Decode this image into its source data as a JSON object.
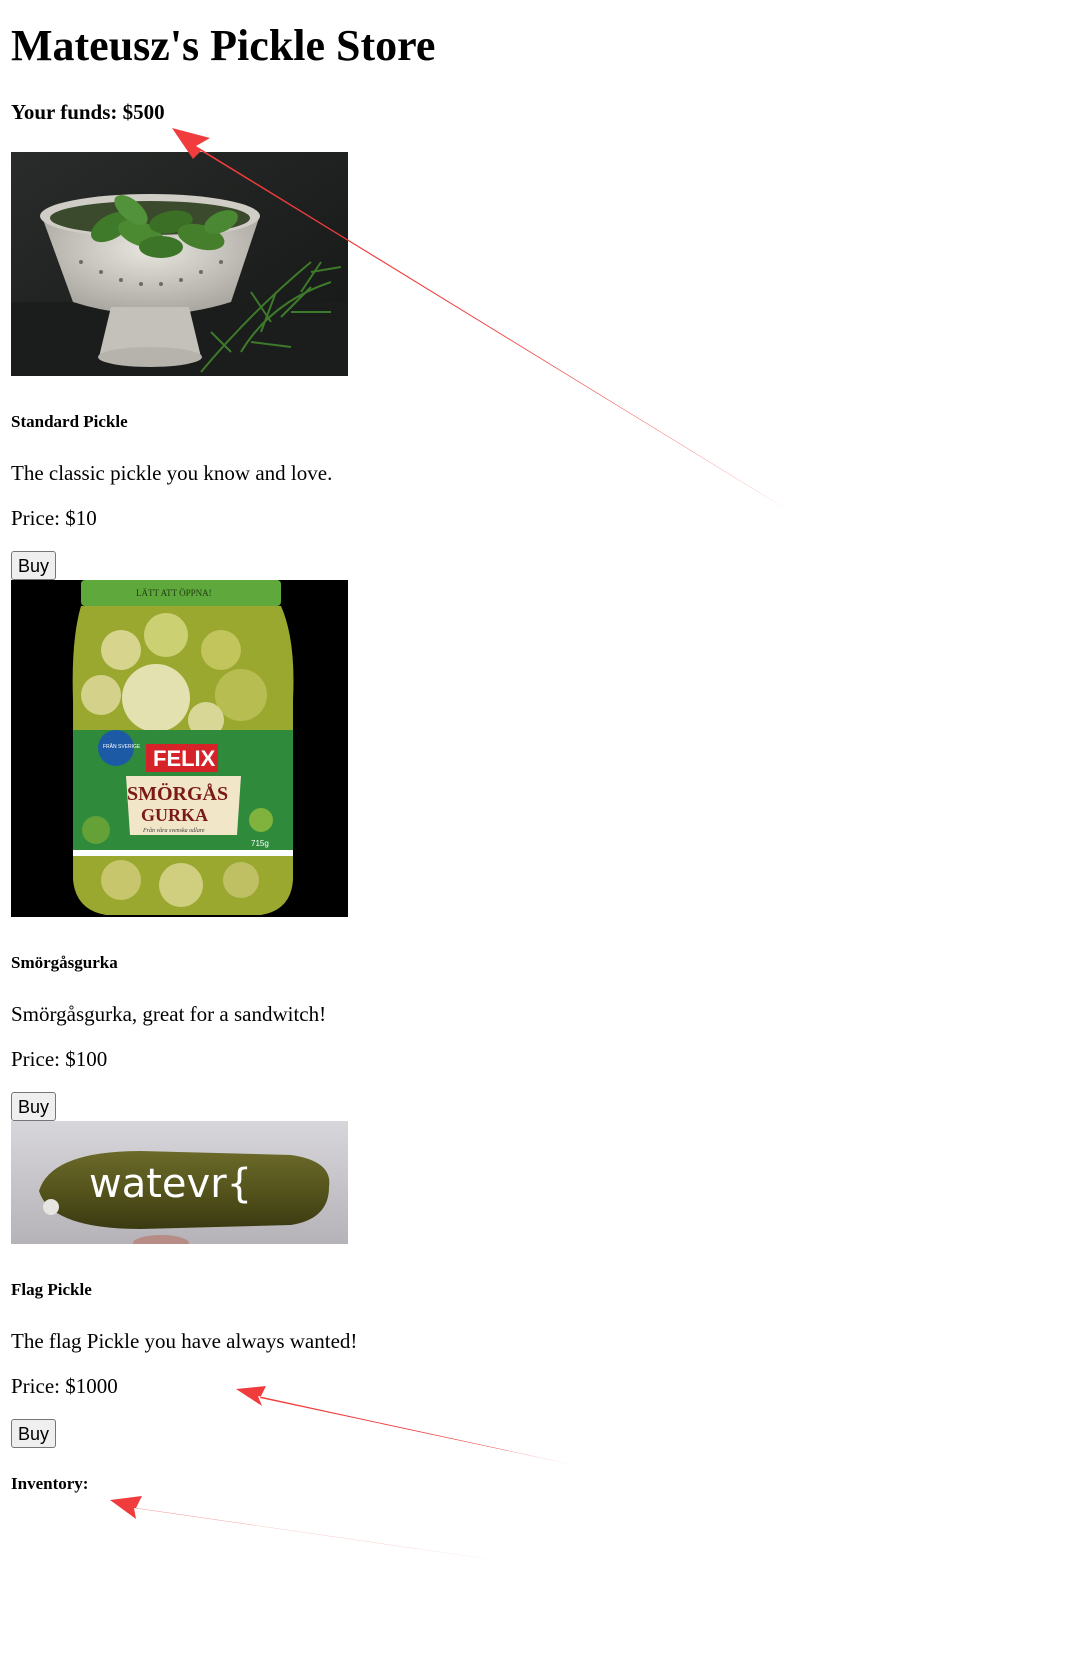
{
  "page": {
    "title": "Mateusz's Pickle Store",
    "funds_label": "Your funds: $500"
  },
  "products": [
    {
      "name": "Standard Pickle",
      "description": "The classic pickle you know and love.",
      "price": "Price: $10",
      "buy_label": "Buy",
      "image": "pickles-in-colander-photo"
    },
    {
      "name": "Smörgåsgurka",
      "description": "Smörgåsgurka, great for a sandwitch!",
      "price": "Price: $100",
      "buy_label": "Buy",
      "image": "pickle-jar-photo",
      "jar_label": {
        "top_band": "LÄTT ATT ÖPPNA!",
        "badge": "FRÅN SVERIGE",
        "brand": "FELIX",
        "product_line1": "SMÖRGÅS",
        "product_line2": "GURKA",
        "tagline": "Från våra svenska odlare",
        "weight": "715g"
      }
    },
    {
      "name": "Flag Pickle",
      "description": "The flag Pickle you have always wanted!",
      "price": "Price: $1000",
      "buy_label": "Buy",
      "image": "pickle-with-text-photo",
      "image_text": "watevr{"
    }
  ],
  "inventory": {
    "label": "Inventory:"
  },
  "annotations": {
    "arrow_color": "#f03c3c"
  },
  "colors": {
    "button_bg": "#efefef",
    "button_border": "#767676"
  }
}
